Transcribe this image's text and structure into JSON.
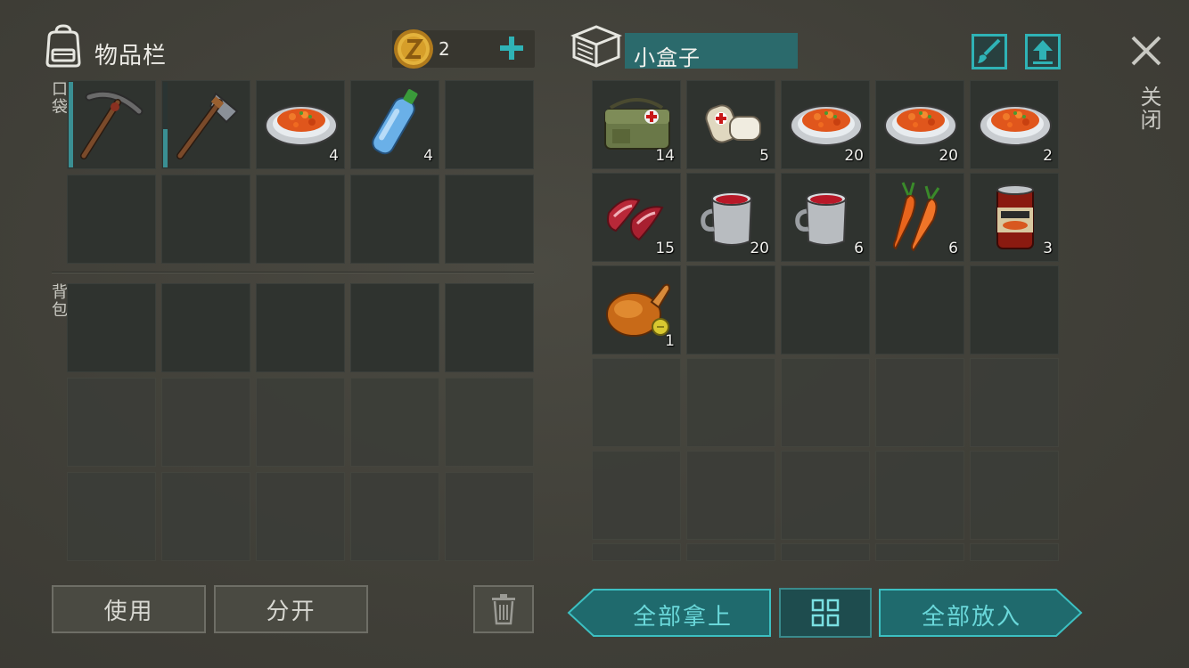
{
  "inventory": {
    "title": "物品栏",
    "coins": "2",
    "pocket_label": "口袋",
    "backpack_label": "背包",
    "pocket_slots": [
      {
        "icon": "pickaxe-icon",
        "count": "",
        "durability": 1.0
      },
      {
        "icon": "pickaxe-icon",
        "count": "",
        "durability": 0.45
      },
      {
        "icon": "carrot-dish-icon",
        "count": "4"
      },
      {
        "icon": "water-bottle-icon",
        "count": "4"
      }
    ]
  },
  "container": {
    "name": "小盒子",
    "close_label": "关闭",
    "slots": [
      {
        "icon": "first-aid-bag-icon",
        "count": "14"
      },
      {
        "icon": "bandage-icon",
        "count": "5"
      },
      {
        "icon": "carrot-dish-icon",
        "count": "20"
      },
      {
        "icon": "carrot-dish-icon",
        "count": "20"
      },
      {
        "icon": "carrot-dish-icon",
        "count": "2"
      },
      {
        "icon": "raw-meat-icon",
        "count": "15"
      },
      {
        "icon": "berry-tea-mug-icon",
        "count": "20"
      },
      {
        "icon": "berry-tea-mug-icon",
        "count": "6"
      },
      {
        "icon": "carrots-icon",
        "count": "6"
      },
      {
        "icon": "canned-food-icon",
        "count": "3"
      },
      {
        "icon": "roast-chicken-icon",
        "count": "1"
      }
    ]
  },
  "buttons": {
    "use": "使用",
    "split": "分开",
    "take_all": "全部拿上",
    "put_all": "全部放入"
  },
  "colors": {
    "accent": "#2fa3a6",
    "accent_dark": "#1f5e62",
    "slot": "#2f332f",
    "background": "#45443c"
  }
}
